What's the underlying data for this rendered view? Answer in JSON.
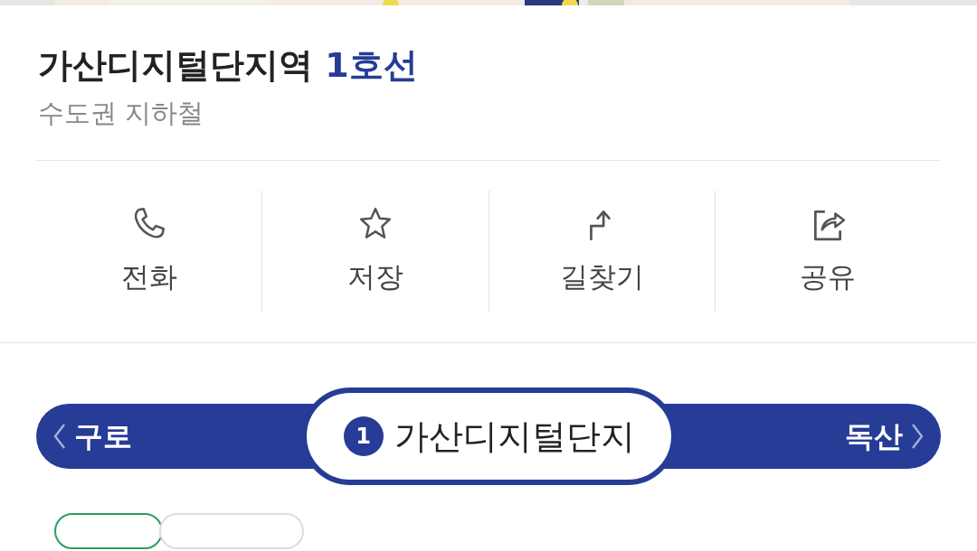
{
  "station": {
    "name": "가산디지털단지역",
    "line": "1호선",
    "category": "수도권 지하철"
  },
  "actions": [
    {
      "kind": "phone",
      "label": "전화"
    },
    {
      "kind": "star",
      "label": "저장"
    },
    {
      "kind": "directions",
      "label": "길찾기"
    },
    {
      "kind": "share",
      "label": "공유"
    }
  ],
  "line_bar": {
    "prev": "구로",
    "current": "가산디지털단지",
    "line_number": "1",
    "next": "독산"
  },
  "chips": [
    {
      "selected": true
    },
    {
      "selected": false
    }
  ]
}
